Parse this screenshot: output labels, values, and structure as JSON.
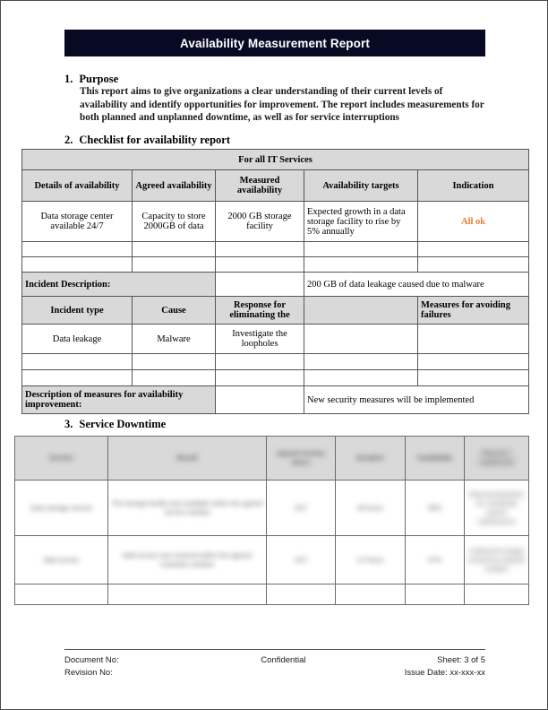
{
  "document": {
    "title": "Availability Measurement Report"
  },
  "sections": {
    "purpose": {
      "number": "1.",
      "heading": "Purpose",
      "body": "This report aims to give organizations a clear understanding of their current levels of availability and identify opportunities for improvement. The report includes measurements for both planned and unplanned downtime, as well as for service interruptions"
    },
    "checklist": {
      "number": "2.",
      "heading": "Checklist for availability report",
      "banner": "For all IT Services",
      "columns": [
        "Details of availability",
        "Agreed availability",
        "Measured availability",
        "Availability targets",
        "Indication"
      ],
      "rows": [
        {
          "details": "Data storage center available 24/7",
          "agreed": "Capacity to store 2000GB of data",
          "measured": "2000 GB storage facility",
          "targets": "Expected growth in a data storage facility to rise by 5% annually",
          "indication": "All ok"
        },
        {
          "details": "",
          "agreed": "",
          "measured": "",
          "targets": "",
          "indication": ""
        },
        {
          "details": "",
          "agreed": "",
          "measured": "",
          "targets": "",
          "indication": ""
        }
      ],
      "incident_description": {
        "label": "Incident Description:",
        "value": "200 GB of data leakage caused due to malware"
      },
      "incident_columns": [
        "Incident type",
        "Cause",
        "Response for eliminating the",
        "",
        "Measures for avoiding failures"
      ],
      "incident_rows": [
        {
          "type": "Data leakage",
          "cause": "Malware",
          "response": "Investigate the loopholes",
          "blank": "",
          "measures": ""
        },
        {
          "type": "",
          "cause": "",
          "response": "",
          "blank": "",
          "measures": ""
        },
        {
          "type": "",
          "cause": "",
          "response": "",
          "blank": "",
          "measures": ""
        }
      ],
      "improvement": {
        "label": "Description of measures for availability improvement:",
        "middle": "",
        "value": "New security measures will be implemented"
      }
    },
    "downtime": {
      "number": "3.",
      "heading": "Service Downtime",
      "redacted": true,
      "columns": [
        "Service",
        "Result",
        "Agreed service hours",
        "Duration",
        "Availability",
        "Planned / Unplanned"
      ],
      "rows": [
        {
          "service": "Data storage service",
          "result": "The storage facility was available within the agreed service window",
          "agreed": "24/7",
          "duration": "48 hours",
          "availability": "99%",
          "planned": "Planned downtime for scheduled system maintenance"
        },
        {
          "service": "Mail service",
          "result": "Mail service was restored within the agreed resolution window",
          "agreed": "24/7",
          "duration": "12 hours",
          "availability": "97%",
          "planned": "Unplanned outage caused by malware incident"
        },
        {
          "service": "",
          "result": "",
          "agreed": "",
          "duration": "",
          "availability": "",
          "planned": ""
        }
      ]
    }
  },
  "footer": {
    "document_no_label": "Document No:",
    "revision_no_label": "Revision No:",
    "confidential": "Confidential",
    "sheet": "Sheet: 3 of 5",
    "issue_date": "Issue Date: xx-xxx-xx"
  },
  "colors": {
    "banner_bg": "#080a24",
    "header_fill": "#d9d9d9",
    "indication_ok": "#ED7D31",
    "border": "#555555"
  }
}
